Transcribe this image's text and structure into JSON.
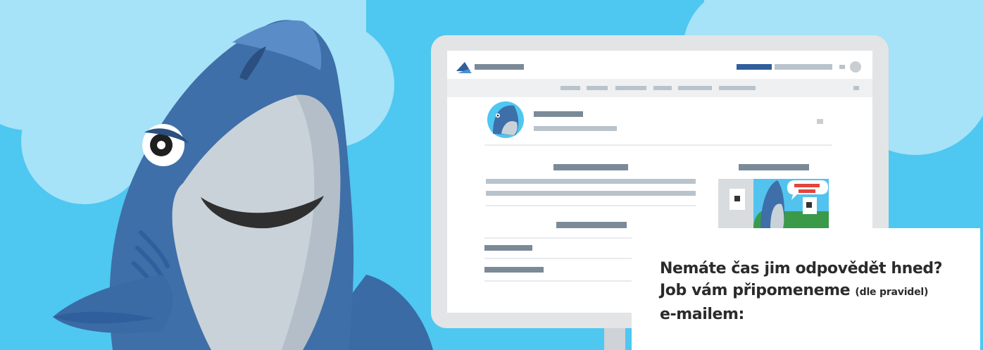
{
  "callout": {
    "line1": "Nemáte čas jim odpovědět hned?",
    "line2_main": "Job vám připomeneme",
    "line2_note": "(dle pravidel)",
    "line3": "e-mailem:"
  },
  "colors": {
    "sky": "#4ec7f1",
    "cloud": "#9fe0f8",
    "shark_blue": "#3e6fa8",
    "shark_belly": "#c9d2d9",
    "monitor_frame": "#e3e4e6",
    "navy_bar": "#2f5f9c",
    "placeholder_gray": "#7b8a98",
    "light_gray": "#b9c3cc",
    "callout_bg": "#ffffff",
    "text_dark": "#2b2b2b",
    "bubble_red": "#e2453c"
  },
  "icons": [
    "shark-mascot",
    "job-logo-icon",
    "avatar-shark-icon",
    "menu-dot-icon"
  ]
}
